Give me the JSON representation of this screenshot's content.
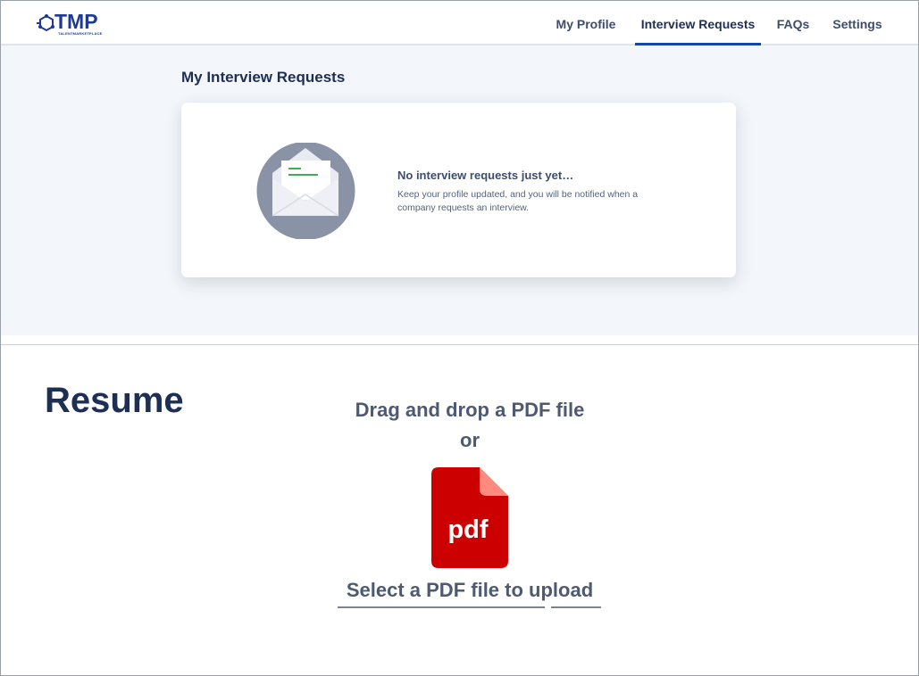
{
  "header": {
    "logo_text": "TMP",
    "logo_subtext": "TALENTMARKETPLACE",
    "nav": [
      {
        "label": "My Profile",
        "active": false
      },
      {
        "label": "Interview Requests",
        "active": true
      },
      {
        "label": "FAQs",
        "active": false
      },
      {
        "label": "Settings",
        "active": false
      }
    ]
  },
  "interview_requests": {
    "title": "My Interview Requests",
    "empty_icon": "open-envelope-icon",
    "empty_title": "No interview requests just yet…",
    "empty_description": "Keep your profile updated, and you will be notified when a company requests an interview."
  },
  "resume": {
    "title": "Resume",
    "drag_text": "Drag and drop a PDF file",
    "or_text": "or",
    "file_icon": "pdf-file-icon",
    "file_icon_label": "pdf",
    "select_link": "Select a PDF file to upload"
  },
  "colors": {
    "brand_navy": "#1e2f55",
    "nav_active_underline": "#1446a8",
    "section_background": "#f3f6fa",
    "pdf_red": "#cc0000",
    "envelope_circle": "#8a92a6",
    "envelope_line": "#3dae5a"
  }
}
